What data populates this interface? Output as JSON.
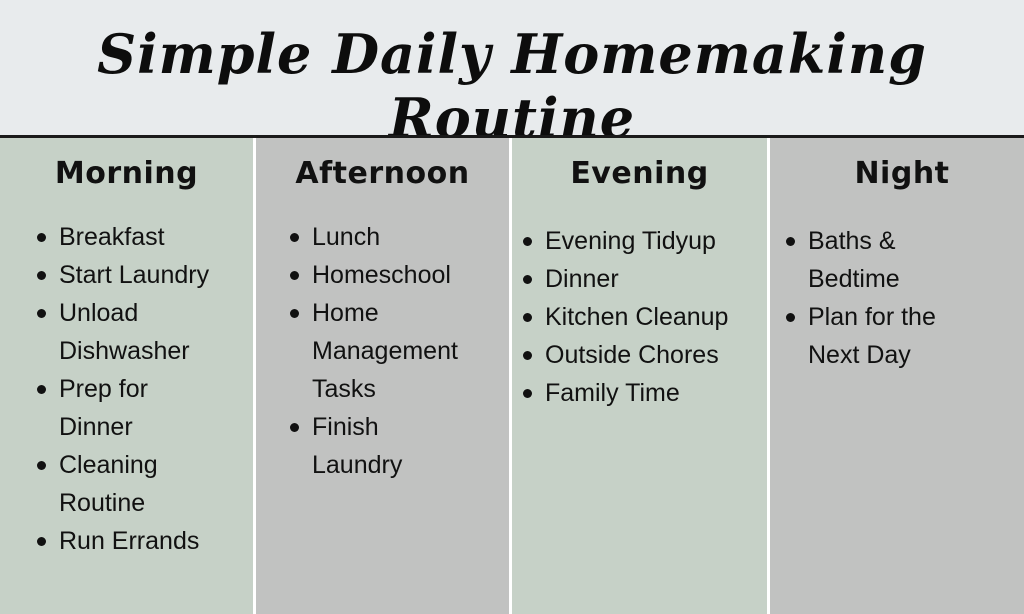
{
  "title": "Simple Daily Homemaking Routine",
  "colors": {
    "header_bg": "#e8ebed",
    "green_col": "#c6d1c7",
    "gray_col": "#c1c2c1",
    "text": "#111111"
  },
  "columns": [
    {
      "heading": "Morning",
      "items": [
        "Breakfast",
        "Start Laundry",
        "Unload Dishwasher",
        "Prep for Dinner",
        "Cleaning Routine",
        "Run Errands"
      ]
    },
    {
      "heading": "Afternoon",
      "items": [
        "Lunch",
        "Homeschool",
        "Home Management Tasks",
        "Finish Laundry"
      ]
    },
    {
      "heading": "Evening",
      "items": [
        "Evening Tidyup",
        "Dinner",
        "Kitchen Cleanup",
        "Outside Chores",
        "Family Time"
      ]
    },
    {
      "heading": "Night",
      "items": [
        "Baths & Bedtime",
        "Plan for the Next Day"
      ]
    }
  ]
}
